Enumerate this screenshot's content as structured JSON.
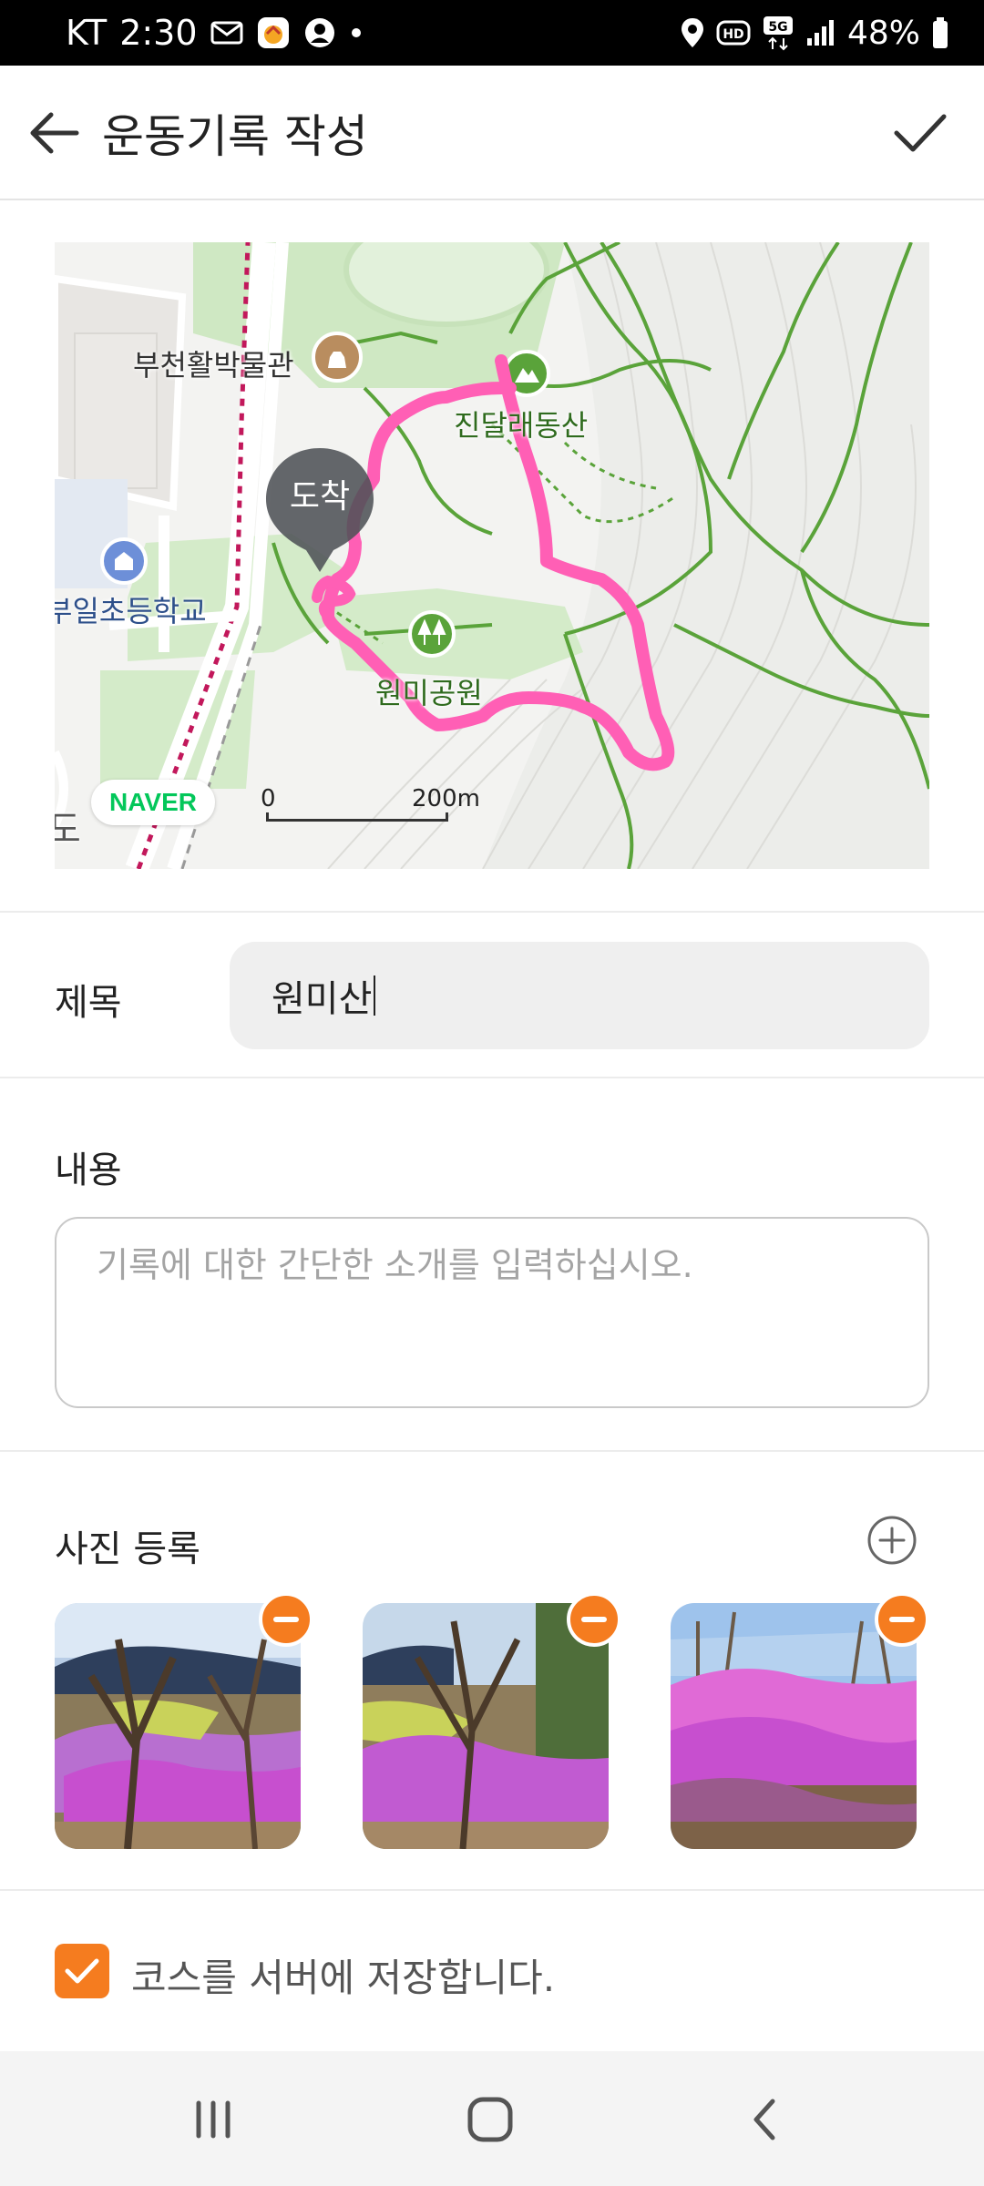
{
  "status_bar": {
    "carrier": "KT",
    "time": "2:30",
    "battery": "48%",
    "network": "5G",
    "hd": "HD"
  },
  "app_bar": {
    "title": "운동기록 작성"
  },
  "map": {
    "labels": {
      "museum": "부천활박물관",
      "mountain": "진달래동산",
      "school": "부일초등학교",
      "park": "원미공원",
      "partial_left": "도"
    },
    "arrival_marker": "도착",
    "naver_logo": "NAVER",
    "scale_start": "0",
    "scale_distance": "200m",
    "route_color": "#ff5fb5"
  },
  "form": {
    "title_label": "제목",
    "title_value": "원미산",
    "content_label": "내용",
    "content_placeholder": "기록에 대한 간단한 소개를 입력하십시오.",
    "photo_label": "사진 등록",
    "photo_count": 3,
    "save_course_label": "코스를 서버에 저장합니다.",
    "save_course_checked": true
  },
  "colors": {
    "accent": "#f57c1f",
    "status_bar": "#000000",
    "nav_bar": "#f4f4f4"
  },
  "icons": {
    "back": "arrow-left-icon",
    "confirm": "check-icon",
    "add_photo": "plus-circle-icon",
    "remove_photo": "minus-circle-icon",
    "nav_recent": "recent-apps-icon",
    "nav_home": "home-icon",
    "nav_back": "chevron-left-icon"
  }
}
